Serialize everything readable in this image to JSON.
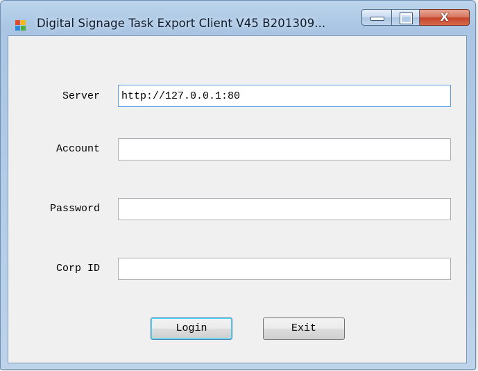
{
  "window": {
    "title": "Digital Signage Task Export Client V45 B201309...",
    "close_glyph": "X"
  },
  "icons": {
    "app": "app-icon",
    "minimize": "minimize-icon",
    "maximize": "maximize-icon",
    "close": "close-icon"
  },
  "form": {
    "server_label": "Server",
    "server_value": "http://127.0.0.1:80",
    "account_label": "Account",
    "account_value": "",
    "password_label": "Password",
    "password_value": "",
    "corp_label": "Corp ID",
    "corp_value": ""
  },
  "buttons": {
    "login": "Login",
    "exit": "Exit"
  },
  "colors": {
    "frame": "#a9c5e3",
    "close_button": "#c6452b",
    "focus_border": "#569de5"
  }
}
